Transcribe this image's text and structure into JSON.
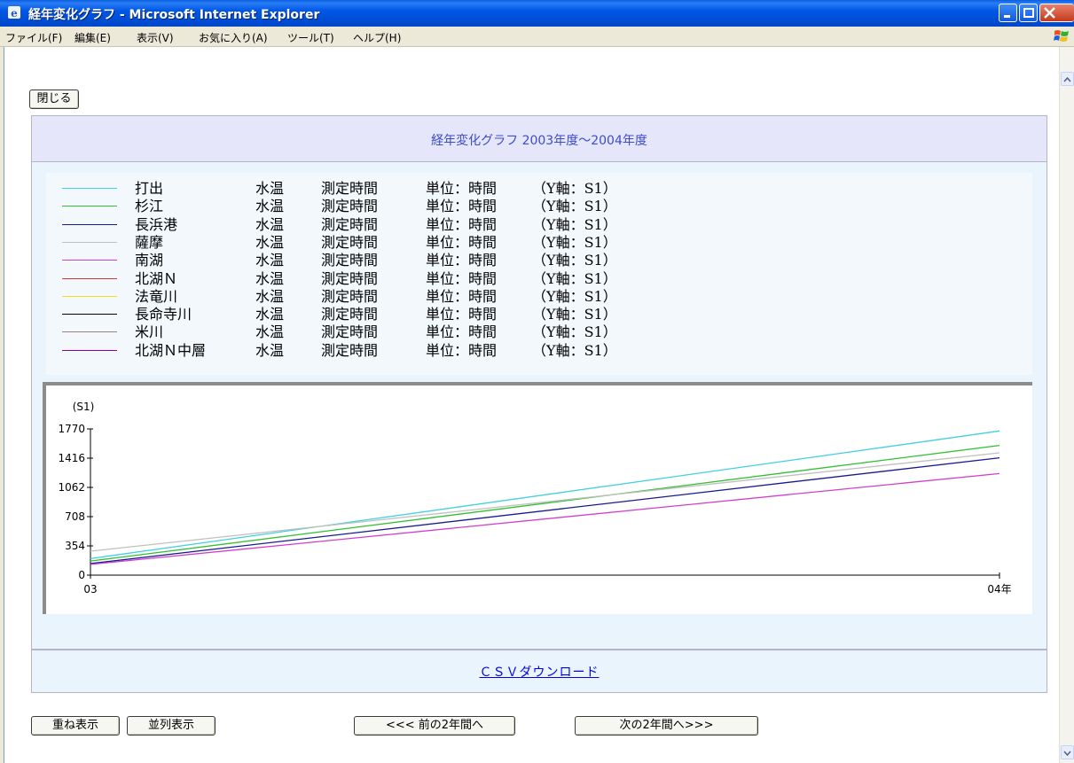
{
  "window": {
    "title": "経年変化グラフ - Microsoft Internet Explorer"
  },
  "menu": [
    "ファイル(F)",
    "編集(E)",
    "表示(V)",
    "お気に入り(A)",
    "ツール(T)",
    "ヘルプ(H)"
  ],
  "buttons": {
    "close": "閉じる",
    "overlay": "重ね表示",
    "parallel": "並列表示",
    "prev": "<<< 前の2年間へ",
    "next": "次の2年間へ>>>"
  },
  "page": {
    "heading": "経年変化グラフ 2003年度～2004年度",
    "csv_link": "ＣＳＶダウンロード"
  },
  "legend": [
    {
      "station": "打出",
      "item": "水温",
      "metric": "測定時間",
      "unit": "単位：時間",
      "axis": "（Y軸：S1）",
      "color": "#40d0e0"
    },
    {
      "station": "杉江",
      "item": "水温",
      "metric": "測定時間",
      "unit": "単位：時間",
      "axis": "（Y軸：S1）",
      "color": "#30c030"
    },
    {
      "station": "長浜港",
      "item": "水温",
      "metric": "測定時間",
      "unit": "単位：時間",
      "axis": "（Y軸：S1）",
      "color": "#1a1a90"
    },
    {
      "station": "薩摩",
      "item": "水温",
      "metric": "測定時間",
      "unit": "単位：時間",
      "axis": "（Y軸：S1）",
      "color": "#c0c0c0"
    },
    {
      "station": "南湖",
      "item": "水温",
      "metric": "測定時間",
      "unit": "単位：時間",
      "axis": "（Y軸：S1）",
      "color": "#d040d0"
    },
    {
      "station": "北湖Ｎ",
      "item": "水温",
      "metric": "測定時間",
      "unit": "単位：時間",
      "axis": "（Y軸：S1）",
      "color": "#e03030"
    },
    {
      "station": "法竜川",
      "item": "水温",
      "metric": "測定時間",
      "unit": "単位：時間",
      "axis": "（Y軸：S1）",
      "color": "#f0e020"
    },
    {
      "station": "長命寺川",
      "item": "水温",
      "metric": "測定時間",
      "unit": "単位：時間",
      "axis": "（Y軸：S1）",
      "color": "#000000"
    },
    {
      "station": "米川",
      "item": "水温",
      "metric": "測定時間",
      "unit": "単位：時間",
      "axis": "（Y軸：S1）",
      "color": "#a08080"
    },
    {
      "station": "北湖Ｎ中層",
      "item": "水温",
      "metric": "測定時間",
      "unit": "単位：時間",
      "axis": "（Y軸：S1）",
      "color": "#900090"
    }
  ],
  "chart_data": {
    "type": "line",
    "ylabel": "(S1)",
    "yticks": [
      0,
      354,
      708,
      1062,
      1416,
      1770
    ],
    "ylim": [
      0,
      1770
    ],
    "x": [
      "03",
      "04年"
    ],
    "grid": false,
    "series": [
      {
        "name": "打出",
        "values": [
          200,
          1745
        ],
        "color": "#40d0e0"
      },
      {
        "name": "杉江",
        "values": [
          170,
          1570
        ],
        "color": "#30c030"
      },
      {
        "name": "長浜港",
        "values": [
          140,
          1420
        ],
        "color": "#1a1a90"
      },
      {
        "name": "薩摩",
        "values": [
          290,
          1480
        ],
        "color": "#c0c0c0"
      },
      {
        "name": "南湖",
        "values": [
          130,
          1230
        ],
        "color": "#d040d0"
      }
    ]
  }
}
